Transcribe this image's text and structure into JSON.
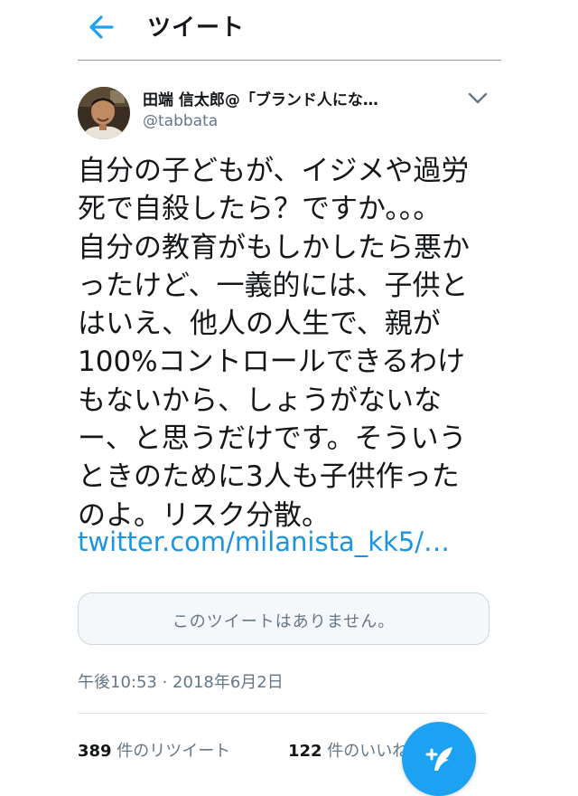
{
  "header": {
    "title": "ツイート"
  },
  "tweet": {
    "author_name": "田端 信太郎@「ブランド人にな…",
    "author_handle": "@tabbata",
    "text_lines": [
      "自分の子どもが、イジメや過労",
      "死で自殺したら？ですか。。。",
      "自分の教育がもしかしたら悪か",
      "ったけど、一義的には、子供と",
      "はいえ、他人の人生で、親が",
      "100%コントロールできるわけ",
      "もないから、しょうがないな",
      "ー、と思うだけです。そういう",
      "ときのために3人も子供作った",
      "のよ。リスク分散。"
    ],
    "link": "twitter.com/milanista_kk5/…",
    "quote_unavailable": "このツイートはありません。",
    "timestamp": "午後10:53 · 2018年6月2日",
    "retweet_count": "389",
    "retweet_label": " 件のリツイート",
    "like_count": "122",
    "like_label": " 件のいいね"
  },
  "colors": {
    "accent": "#1da1f2",
    "link": "#1b95e0",
    "secondary_text": "#657786"
  },
  "icons": {
    "back": "arrow-left-icon",
    "menu": "chevron-down-icon",
    "compose": "compose-feather-icon"
  }
}
